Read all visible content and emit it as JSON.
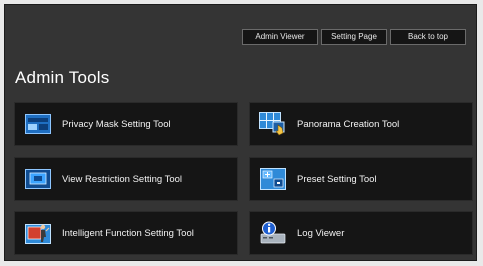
{
  "nav": {
    "admin_viewer": "Admin Viewer",
    "setting_page": "Setting Page",
    "back_to_top": "Back to top"
  },
  "page_title": "Admin Tools",
  "tools": [
    {
      "label": "Privacy Mask Setting Tool",
      "icon": "privacy-mask-icon"
    },
    {
      "label": "Panorama Creation Tool",
      "icon": "panorama-icon"
    },
    {
      "label": "View Restriction Setting Tool",
      "icon": "view-restriction-icon"
    },
    {
      "label": "Preset Setting Tool",
      "icon": "preset-icon"
    },
    {
      "label": "Intelligent Function Setting Tool",
      "icon": "intelligent-function-icon"
    },
    {
      "label": "Log Viewer",
      "icon": "log-viewer-icon"
    }
  ],
  "colors": {
    "background": "#343434",
    "tile": "#151515",
    "text": "#f2f2f2",
    "icon_blue": "#2f8ad8"
  }
}
